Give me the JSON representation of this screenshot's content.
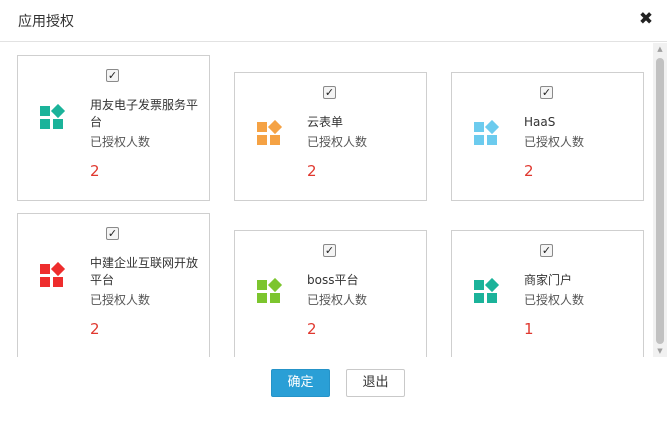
{
  "dialog": {
    "title": "应用授权",
    "close_icon": "close-icon"
  },
  "cards": [
    {
      "name": "用友电子发票服务平台",
      "auth_label": "已授权人数",
      "count": "2",
      "checked": true,
      "icon_color": "#1bb39a"
    },
    {
      "name": "云表单",
      "auth_label": "已授权人数",
      "count": "2",
      "checked": true,
      "icon_color": "#f5a244"
    },
    {
      "name": "HaaS",
      "auth_label": "已授权人数",
      "count": "2",
      "checked": true,
      "icon_color": "#6ccbee"
    },
    {
      "name": "中建企业互联网开放平台",
      "auth_label": "已授权人数",
      "count": "2",
      "checked": true,
      "icon_color": "#ee2d2d"
    },
    {
      "name": "boss平台",
      "auth_label": "已授权人数",
      "count": "2",
      "checked": true,
      "icon_color": "#7cc52e"
    },
    {
      "name": "商家门户",
      "auth_label": "已授权人数",
      "count": "1",
      "checked": true,
      "icon_color": "#1bb39a"
    }
  ],
  "footer": {
    "ok_label": "确定",
    "exit_label": "退出"
  },
  "colors": {
    "primary": "#2a9fd6",
    "count": "#e0382f"
  }
}
